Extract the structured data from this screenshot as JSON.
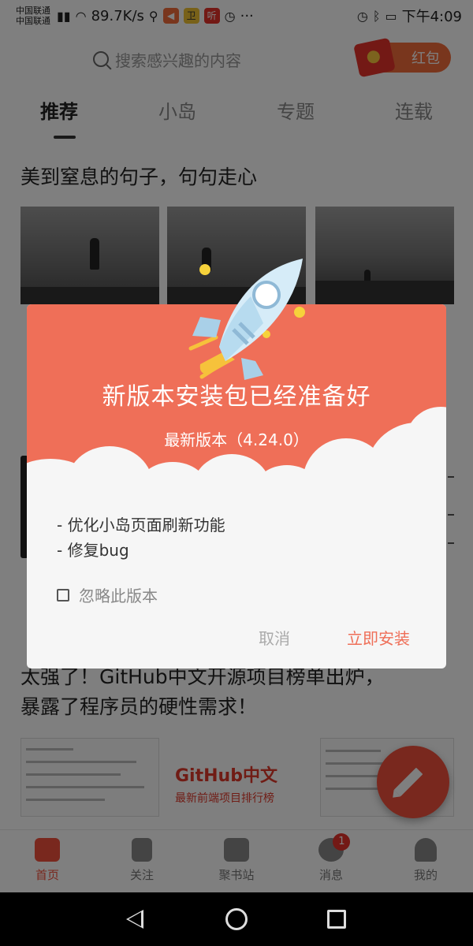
{
  "status_bar": {
    "carrier_1": "中国联通",
    "carrier_2": "中国联通",
    "speed": "89.7K/s",
    "app_badge_1": "◀",
    "app_badge_2": "卫",
    "app_badge_3": "听",
    "more": "···",
    "time": "下午4:09"
  },
  "header": {
    "search_placeholder": "搜索感兴趣的内容",
    "redpack_label": "红包"
  },
  "tabs": [
    {
      "label": "推荐"
    },
    {
      "label": "小岛"
    },
    {
      "label": "专题"
    },
    {
      "label": "连载"
    }
  ],
  "feed": {
    "article_1_title": "美到窒息的句子，句句走心",
    "article_2_title_line1": "太强了！GitHub中文开源项目榜单出炉，",
    "article_2_title_line2": "暴露了程序员的硬性需求！",
    "banner_line1": "GitHub中文",
    "banner_line2": "最新前端项目排行榜"
  },
  "bottom_nav": [
    {
      "label": "首页"
    },
    {
      "label": "关注"
    },
    {
      "label": "聚书站"
    },
    {
      "label": "消息",
      "badge": "1"
    },
    {
      "label": "我的"
    }
  ],
  "dialog": {
    "title": "新版本安装包已经准备好",
    "version": "最新版本（4.24.0）",
    "changes_line1": "- 优化小岛页面刷新功能",
    "changes_line2": "- 修复bug",
    "ignore_label": "忽略此版本",
    "cancel_label": "取消",
    "install_label": "立即安装"
  },
  "colors": {
    "accent": "#f3503c",
    "dialog_header": "#ef6f58"
  }
}
